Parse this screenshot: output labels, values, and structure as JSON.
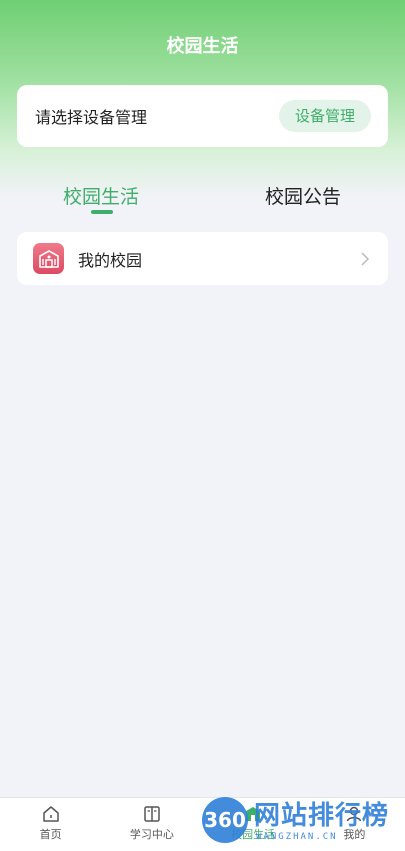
{
  "header": {
    "title": "校园生活"
  },
  "device": {
    "prompt": "请选择设备管理",
    "button_label": "设备管理"
  },
  "tabs": [
    {
      "label": "校园生活",
      "active": true
    },
    {
      "label": "校园公告",
      "active": false
    }
  ],
  "list": [
    {
      "label": "我的校园",
      "icon": "campus-building-icon"
    }
  ],
  "bottom_nav": [
    {
      "label": "首页",
      "icon": "home-icon"
    },
    {
      "label": "学习中心",
      "icon": "book-icon"
    },
    {
      "label": "校园生活",
      "icon": "campus-icon"
    },
    {
      "label": "我的",
      "icon": "user-icon"
    }
  ],
  "watermark": {
    "logo": "360",
    "name": "网站排行榜",
    "sub": "WANGZHAN.CN"
  },
  "colors": {
    "accent": "#3fae6a",
    "header_green": "#6fcf73",
    "background": "#f2f3f8"
  }
}
